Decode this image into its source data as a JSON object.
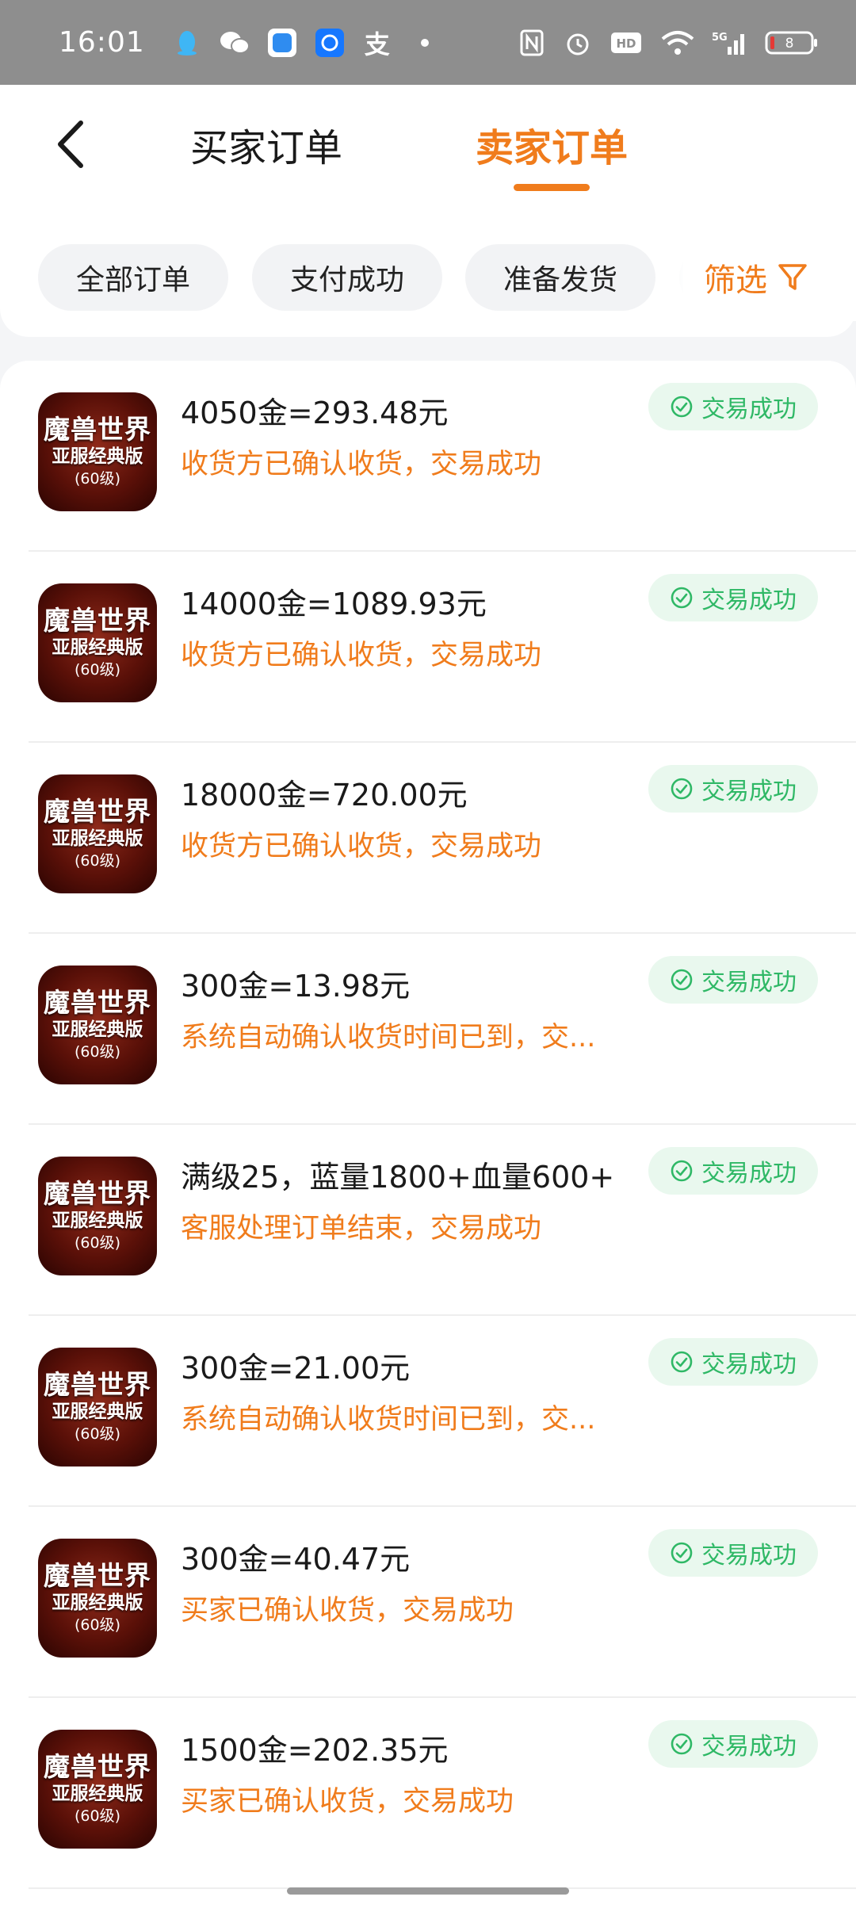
{
  "status_bar": {
    "time": "16:01",
    "alipay_char": "支",
    "battery_level": "8",
    "network_label": "5G",
    "hd_label": "HD"
  },
  "header": {
    "tab_buyer": "买家订单",
    "tab_seller": "卖家订单",
    "active_tab": "seller"
  },
  "filters": {
    "chips": [
      "全部订单",
      "支付成功",
      "准备发货",
      ""
    ],
    "filter_label": "筛选"
  },
  "thumbnail": {
    "line1": "魔兽世界",
    "line2": "亚服经典版",
    "line3": "(60级)"
  },
  "orders": [
    {
      "title": "4050金=293.48元",
      "status_text": "收货方已确认收货，交易成功",
      "badge": "交易成功"
    },
    {
      "title": "14000金=1089.93元",
      "status_text": "收货方已确认收货，交易成功",
      "badge": "交易成功"
    },
    {
      "title": "18000金=720.00元",
      "status_text": "收货方已确认收货，交易成功",
      "badge": "交易成功"
    },
    {
      "title": "300金=13.98元",
      "status_text": "系统自动确认收货时间已到，交...",
      "badge": "交易成功"
    },
    {
      "title": "满级25，蓝量1800+血量600+",
      "status_text": "客服处理订单结束，交易成功",
      "badge": "交易成功"
    },
    {
      "title": "300金=21.00元",
      "status_text": "系统自动确认收货时间已到，交...",
      "badge": "交易成功"
    },
    {
      "title": "300金=40.47元",
      "status_text": "买家已确认收货，交易成功",
      "badge": "交易成功"
    },
    {
      "title": "1500金=202.35元",
      "status_text": "买家已确认收货，交易成功",
      "badge": "交易成功"
    }
  ],
  "colors": {
    "accent": "#f07c1c",
    "success": "#2fb866",
    "success_bg": "#e9f8ee"
  }
}
